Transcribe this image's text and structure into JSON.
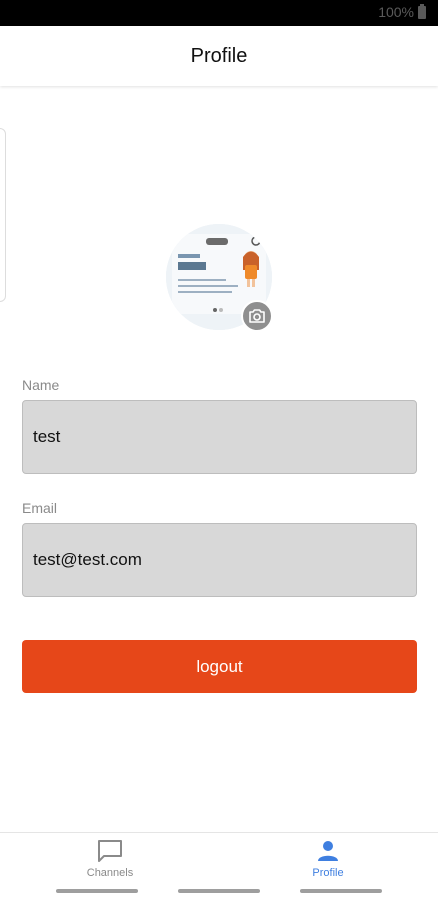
{
  "status_bar": {
    "battery_text": "100%"
  },
  "header": {
    "title": "Profile"
  },
  "avatar": {
    "camera_icon": "camera-icon"
  },
  "form": {
    "name_label": "Name",
    "name_value": "test",
    "email_label": "Email",
    "email_value": "test@test.com"
  },
  "actions": {
    "logout_label": "logout"
  },
  "bottom_nav": {
    "items": [
      {
        "label": "Channels",
        "icon": "chat-bubble-icon",
        "active": false
      },
      {
        "label": "Profile",
        "icon": "person-icon",
        "active": true
      }
    ]
  },
  "colors": {
    "accent": "#e64719",
    "active_nav": "#3f7fe0",
    "input_bg": "#d8d8d8"
  }
}
